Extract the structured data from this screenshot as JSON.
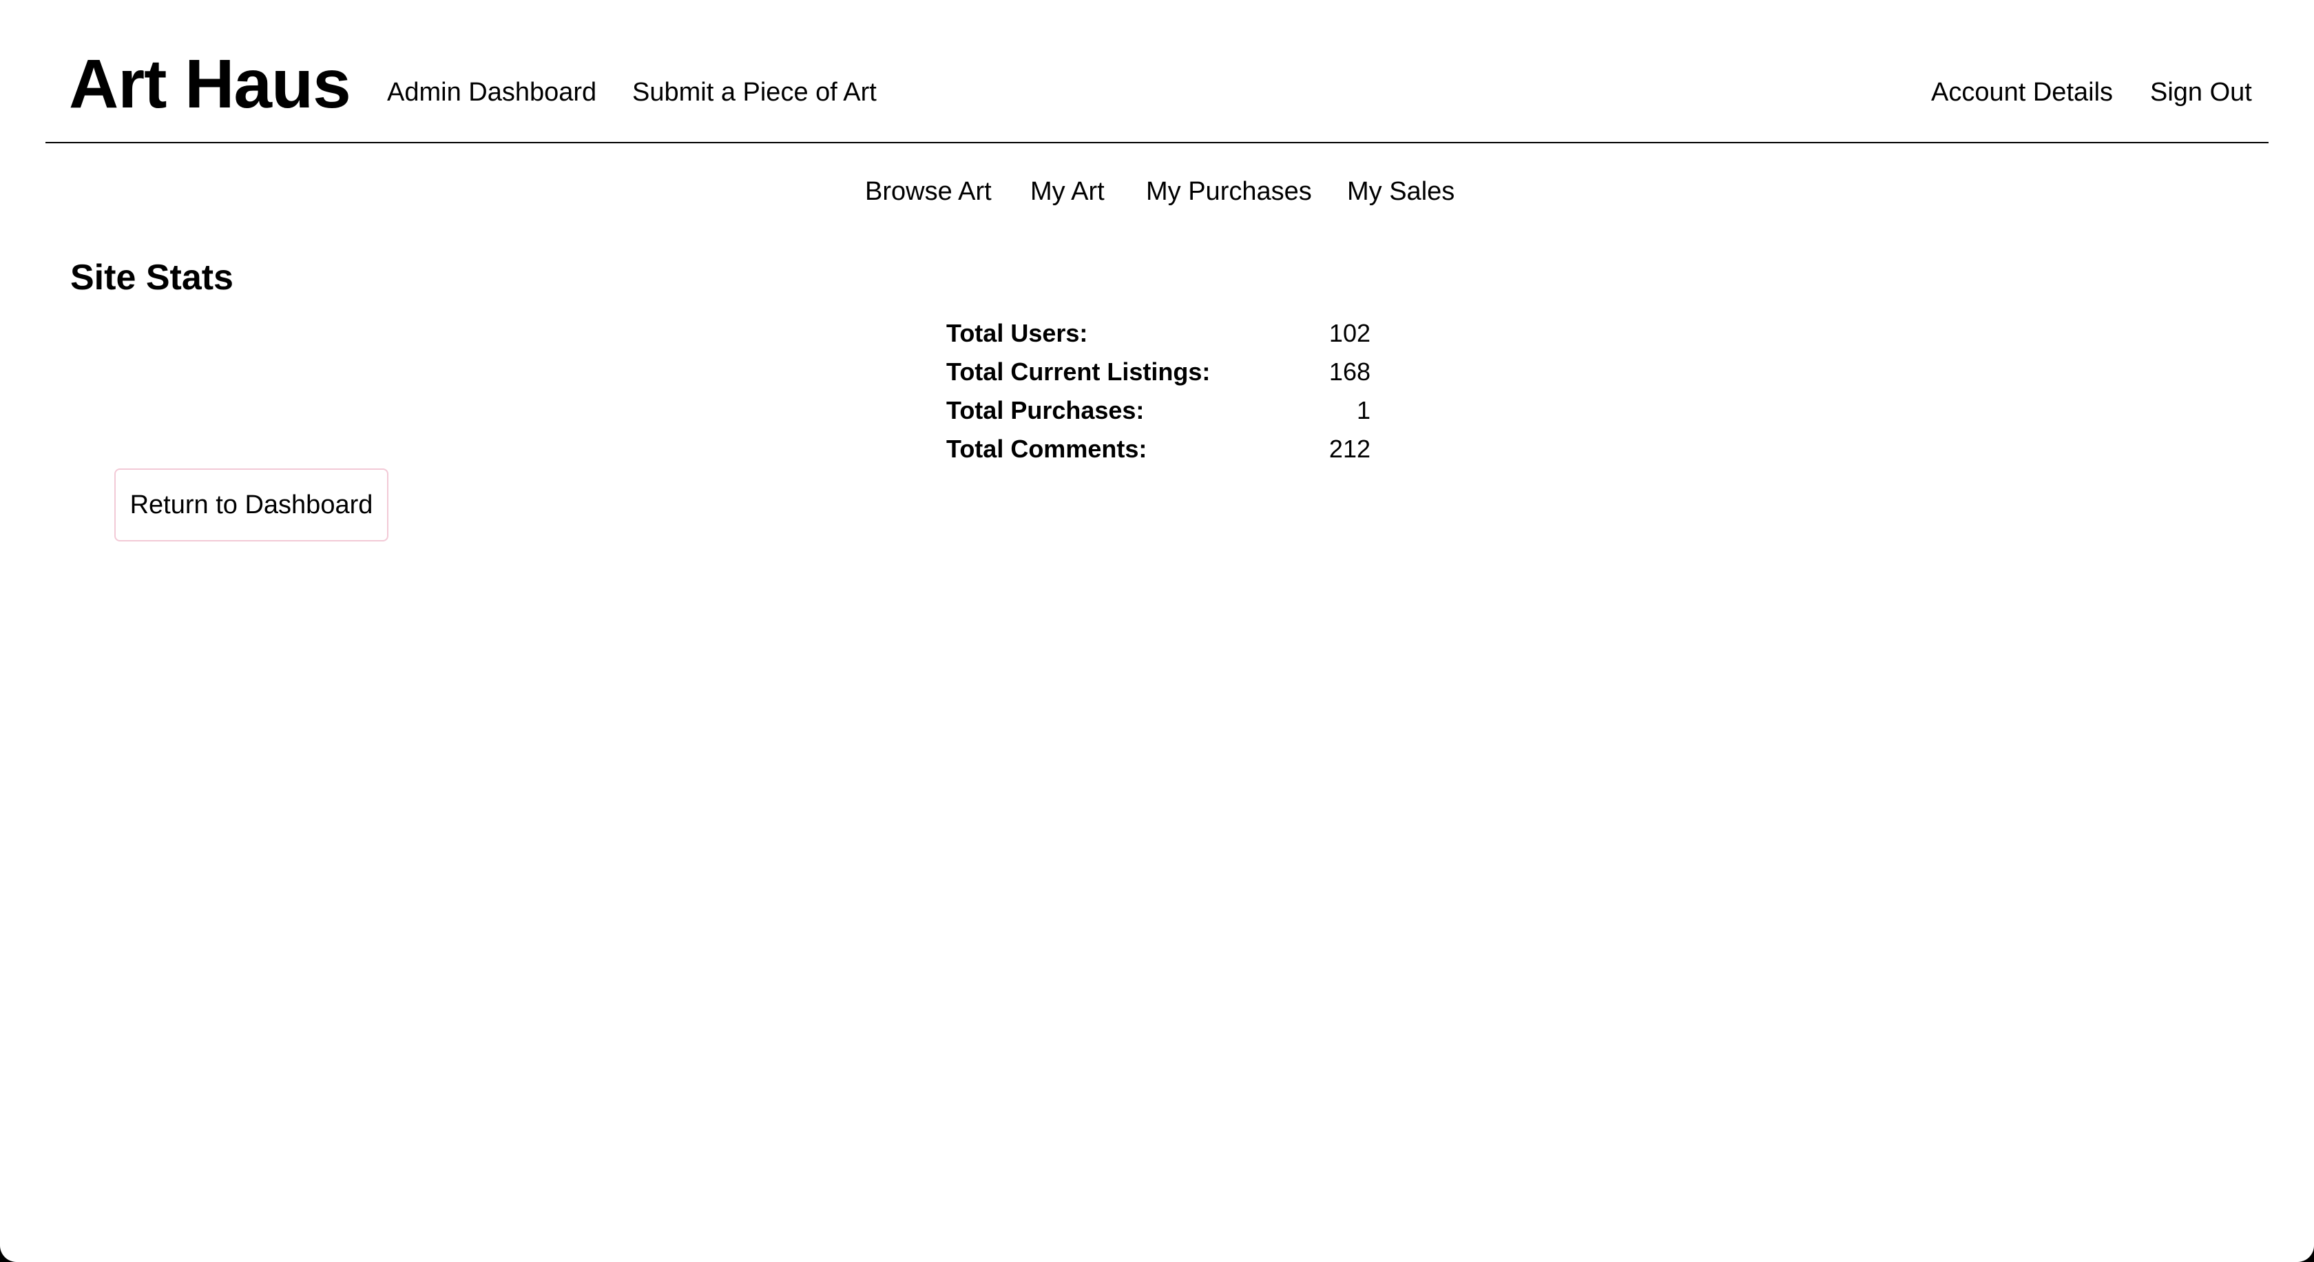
{
  "header": {
    "brand": "Art Haus",
    "left_links": [
      "Admin Dashboard",
      "Submit a Piece of Art"
    ],
    "right_links": [
      "Account Details",
      "Sign Out"
    ]
  },
  "subnav": {
    "items": [
      "Browse Art",
      "My Art",
      "My Purchases",
      "My Sales"
    ]
  },
  "main": {
    "title": "Site Stats",
    "stats": [
      {
        "label": "Total Users:",
        "value": "102"
      },
      {
        "label": "Total Current Listings:",
        "value": "168"
      },
      {
        "label": "Total Purchases:",
        "value": "1"
      },
      {
        "label": "Total Comments:",
        "value": "212"
      }
    ],
    "return_button": "Return to Dashboard"
  },
  "colors": {
    "background": "#ffffff",
    "text": "#000000",
    "button_border": "#f2c9d6"
  }
}
